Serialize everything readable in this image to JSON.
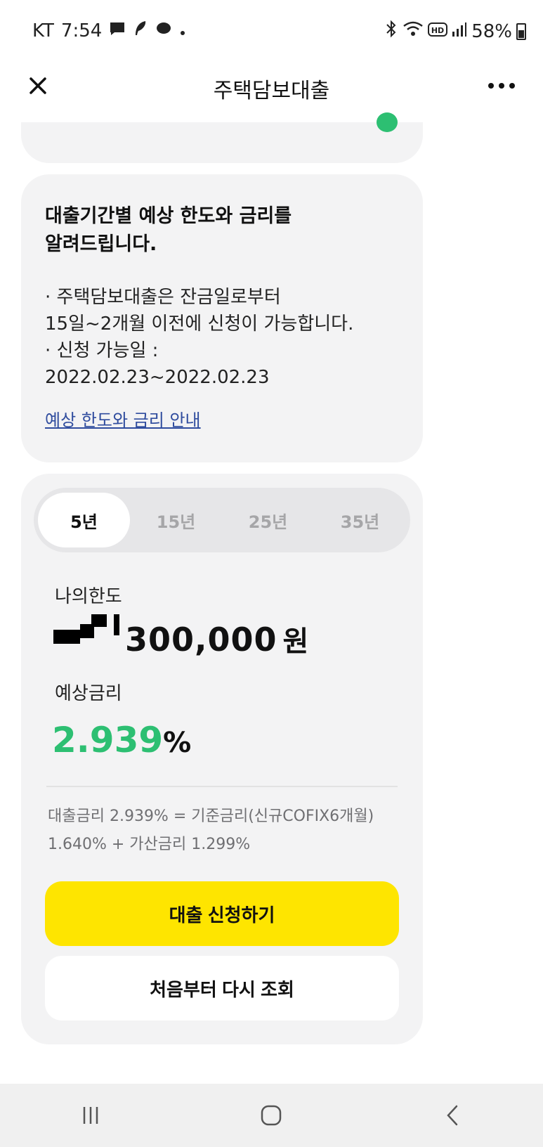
{
  "status_bar": {
    "carrier": "KT",
    "time": "7:54",
    "battery": "58%"
  },
  "header": {
    "title": "주택담보대출"
  },
  "info_card": {
    "title_line1": "대출기간별 예상 한도와 금리를",
    "title_line2": "알려드립니다.",
    "bullet1_line1": "· 주택담보대출은 잔금일로부터",
    "bullet1_line2": "15일~2개월 이전에 신청이 가능합니다.",
    "bullet2_line1": "· 신청 가능일 :",
    "bullet2_line2": "2022.02.23~2022.02.23",
    "link": "예상 한도와 금리 안내"
  },
  "loan_card": {
    "tabs": [
      {
        "label": "5년",
        "active": true
      },
      {
        "label": "15년",
        "active": false
      },
      {
        "label": "25년",
        "active": false
      },
      {
        "label": "35년",
        "active": false
      }
    ],
    "limit_label": "나의한도",
    "limit_amount": "300,000",
    "limit_unit": "원",
    "rate_label": "예상금리",
    "rate_value": "2.939",
    "rate_unit": "%",
    "detail_line1": "대출금리 2.939% = 기준금리(신규COFIX6개월)",
    "detail_line2": "1.640% + 가산금리 1.299%",
    "apply_button": "대출 신청하기",
    "reset_button": "처음부터 다시 조회"
  },
  "colors": {
    "accent_green": "#2dbf72",
    "button_yellow": "#fee500",
    "card_bg": "#f3f3f4",
    "link_blue": "#2f4c9e"
  }
}
